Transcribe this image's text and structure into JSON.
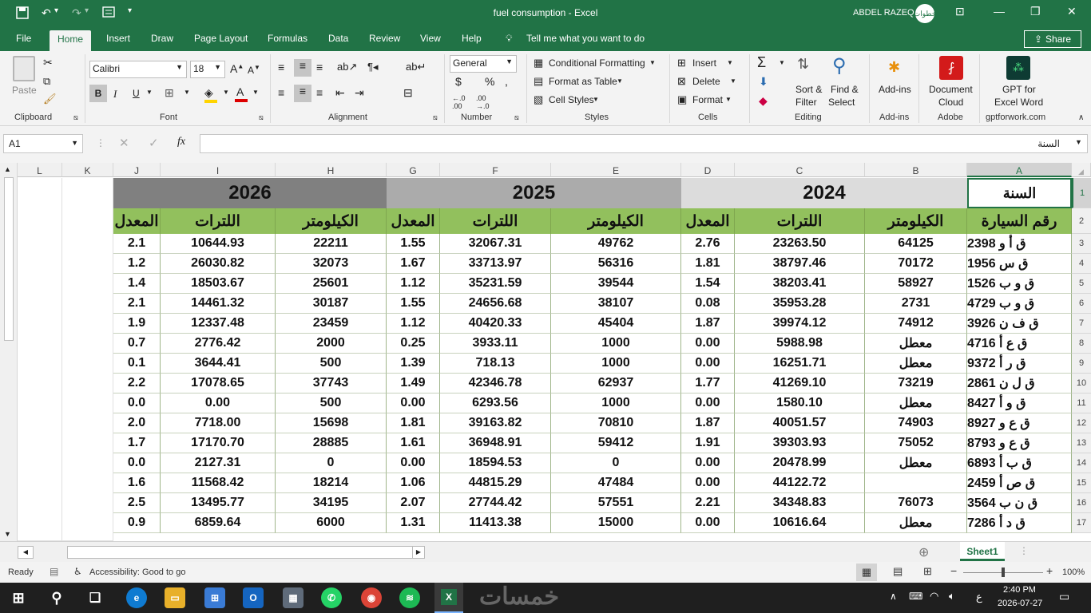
{
  "titlebar": {
    "title": "fuel consumption  -  Excel",
    "user": "ABDEL RAZEQ",
    "avatar": "خطوات"
  },
  "tabs": [
    "File",
    "Home",
    "Insert",
    "Draw",
    "Page Layout",
    "Formulas",
    "Data",
    "Review",
    "View",
    "Help"
  ],
  "tell_me": "Tell me what you want to do",
  "share": "Share",
  "ribbon": {
    "paste": "Paste",
    "font_name": "Calibri",
    "font_size": "18",
    "number_format": "General",
    "conditional": "Conditional Formatting",
    "format_table": "Format as Table",
    "cell_styles": "Cell Styles",
    "insert": "Insert",
    "delete": "Delete",
    "format": "Format",
    "sort1": "Sort &",
    "sort2": "Filter",
    "find1": "Find &",
    "find2": "Select",
    "addins": "Add-ins",
    "doc1": "Document",
    "doc2": "Cloud",
    "gpt1": "GPT for",
    "gpt2": "Excel Word",
    "groups": {
      "clipboard": "Clipboard",
      "font": "Font",
      "alignment": "Alignment",
      "number": "Number",
      "styles": "Styles",
      "cells": "Cells",
      "editing": "Editing",
      "addins": "Add-ins",
      "adobe": "Adobe",
      "gpt": "gptforwork.com"
    }
  },
  "formula_bar": {
    "name_box": "A1",
    "content": "السنة"
  },
  "sheet": {
    "col_letters": [
      "L",
      "K",
      "J",
      "I",
      "H",
      "G",
      "F",
      "E",
      "D",
      "C",
      "B",
      "A"
    ],
    "row_numbers": [
      "1",
      "2",
      "3",
      "4",
      "5",
      "6",
      "7",
      "8",
      "9",
      "10",
      "11",
      "12",
      "13",
      "14",
      "15",
      "16",
      "17"
    ],
    "years": [
      "2026",
      "2025",
      "2024"
    ],
    "a1": "السنة",
    "headers": {
      "car": "رقم السيارة",
      "km": "الكيلومتر",
      "liters": "اللترات",
      "rate": "المعدل"
    },
    "rows": [
      {
        "car": "ق أ و 2398",
        "km24": "64125",
        "l24": "23263.50",
        "r24": "2.76",
        "km25": "49762",
        "l25": "32067.31",
        "r25": "1.55",
        "km26": "22211",
        "l26": "10644.93",
        "r26": "2.1"
      },
      {
        "car": "ق س 1956",
        "km24": "70172",
        "l24": "38797.46",
        "r24": "1.81",
        "km25": "56316",
        "l25": "33713.97",
        "r25": "1.67",
        "km26": "32073",
        "l26": "26030.82",
        "r26": "1.2"
      },
      {
        "car": "ق و ب 1526",
        "km24": "58927",
        "l24": "38203.41",
        "r24": "1.54",
        "km25": "39544",
        "l25": "35231.59",
        "r25": "1.12",
        "km26": "25601",
        "l26": "18503.67",
        "r26": "1.4"
      },
      {
        "car": "ق و ب 4729",
        "km24": "2731",
        "l24": "35953.28",
        "r24": "0.08",
        "km25": "38107",
        "l25": "24656.68",
        "r25": "1.55",
        "km26": "30187",
        "l26": "14461.32",
        "r26": "2.1"
      },
      {
        "car": "ق ف ن 3926",
        "km24": "74912",
        "l24": "39974.12",
        "r24": "1.87",
        "km25": "45404",
        "l25": "40420.33",
        "r25": "1.12",
        "km26": "23459",
        "l26": "12337.48",
        "r26": "1.9"
      },
      {
        "car": "ق ع أ 4716",
        "km24": "معطل",
        "l24": "5988.98",
        "r24": "0.00",
        "km25": "1000",
        "l25": "3933.11",
        "r25": "0.25",
        "km26": "2000",
        "l26": "2776.42",
        "r26": "0.7"
      },
      {
        "car": "ق ر أ 9372",
        "km24": "معطل",
        "l24": "16251.71",
        "r24": "0.00",
        "km25": "1000",
        "l25": "718.13",
        "r25": "1.39",
        "km26": "500",
        "l26": "3644.41",
        "r26": "0.1"
      },
      {
        "car": "ق ل ن 2861",
        "km24": "73219",
        "l24": "41269.10",
        "r24": "1.77",
        "km25": "62937",
        "l25": "42346.78",
        "r25": "1.49",
        "km26": "37743",
        "l26": "17078.65",
        "r26": "2.2"
      },
      {
        "car": "ق و أ 8427",
        "km24": "معطل",
        "l24": "1580.10",
        "r24": "0.00",
        "km25": "1000",
        "l25": "6293.56",
        "r25": "0.00",
        "km26": "500",
        "l26": "0.00",
        "r26": "0.0"
      },
      {
        "car": "ق ع و 8927",
        "km24": "74903",
        "l24": "40051.57",
        "r24": "1.87",
        "km25": "70810",
        "l25": "39163.82",
        "r25": "1.81",
        "km26": "15698",
        "l26": "7718.00",
        "r26": "2.0"
      },
      {
        "car": "ق ع و 8793",
        "km24": "75052",
        "l24": "39303.93",
        "r24": "1.91",
        "km25": "59412",
        "l25": "36948.91",
        "r25": "1.61",
        "km26": "28885",
        "l26": "17170.70",
        "r26": "1.7"
      },
      {
        "car": "ق ب أ 6893",
        "km24": "معطل",
        "l24": "20478.99",
        "r24": "0.00",
        "km25": "0",
        "l25": "18594.53",
        "r25": "0.00",
        "km26": "0",
        "l26": "2127.31",
        "r26": "0.0"
      },
      {
        "car": "ق ص أ 2459",
        "km24": "",
        "l24": "44122.72",
        "r24": "0.00",
        "km25": "47484",
        "l25": "44815.29",
        "r25": "1.06",
        "km26": "18214",
        "l26": "11568.42",
        "r26": "1.6"
      },
      {
        "car": "ق ن ب 3564",
        "km24": "76073",
        "l24": "34348.83",
        "r24": "2.21",
        "km25": "57551",
        "l25": "27744.42",
        "r25": "2.07",
        "km26": "34195",
        "l26": "13495.77",
        "r26": "2.5"
      },
      {
        "car": "ق د أ 7286",
        "km24": "معطل",
        "l24": "10616.64",
        "r24": "0.00",
        "km25": "15000",
        "l25": "11413.38",
        "r25": "1.31",
        "km26": "6000",
        "l26": "6859.64",
        "r26": "0.9"
      }
    ]
  },
  "sheet_tab": "Sheet1",
  "status": {
    "ready": "Ready",
    "accessibility": "Accessibility: Good to go",
    "zoom": "100%"
  },
  "taskbar": {
    "time": "2:40 PM",
    "date": "2026-07-27",
    "lang": "ع",
    "watermark": "خمسات"
  },
  "colors": {
    "excel_green": "#217346",
    "header_green": "#92c05d",
    "year_2026": "#808080",
    "year_2025": "#ababab",
    "year_2024": "#dcdcdc"
  }
}
